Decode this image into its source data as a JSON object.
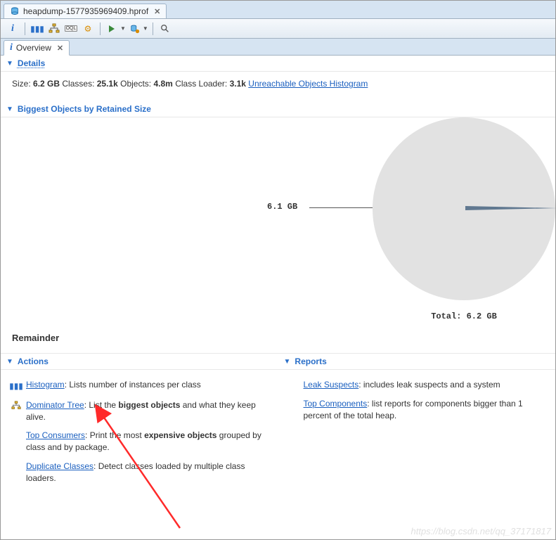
{
  "editor_tab": {
    "filename": "heapdump-1577935969409.hprof"
  },
  "inner_tab": {
    "label": "Overview"
  },
  "sections": {
    "details_title": "Details",
    "biggest_title": "Biggest Objects by Retained Size",
    "actions_title": "Actions",
    "reports_title": "Reports"
  },
  "details": {
    "size_label": "Size:",
    "size_value": "6.2 GB",
    "classes_label": "Classes:",
    "classes_value": "25.1k",
    "objects_label": "Objects:",
    "objects_value": "4.8m",
    "classloader_label": "Class Loader:",
    "classloader_value": "3.1k",
    "unreachable_link": "Unreachable Objects Histogram"
  },
  "chart": {
    "slice_label": "6.1 GB",
    "total_label": "Total: 6.2 GB",
    "remainder_label": "Remainder"
  },
  "actions": {
    "histogram_link": "Histogram",
    "histogram_desc": ": Lists number of instances per class",
    "dominator_link": "Dominator Tree",
    "dominator_desc_pre": ": List the ",
    "dominator_desc_bold": "biggest objects",
    "dominator_desc_post": " and what they keep alive.",
    "top_consumers_link": "Top Consumers",
    "top_consumers_pre": ": Print the most ",
    "top_consumers_bold": "expensive objects",
    "top_consumers_post": " grouped by class and by package.",
    "duplicate_link": "Duplicate Classes",
    "duplicate_desc": ": Detect classes loaded by multiple class loaders."
  },
  "reports": {
    "leak_link": "Leak Suspects",
    "leak_desc": ": includes leak suspects and a system",
    "top_comp_link": "Top Components",
    "top_comp_desc": ": list reports for components bigger than 1 percent of the total heap."
  },
  "watermark": "https://blog.csdn.net/qq_37171817",
  "chart_data": {
    "type": "pie",
    "title": "Biggest Objects by Retained Size",
    "total_label": "Total: 6.2 GB",
    "series": [
      {
        "name": "6.1 GB",
        "value": 6.1
      },
      {
        "name": "Remainder",
        "value": 0.1
      }
    ],
    "total": 6.2,
    "unit": "GB"
  }
}
